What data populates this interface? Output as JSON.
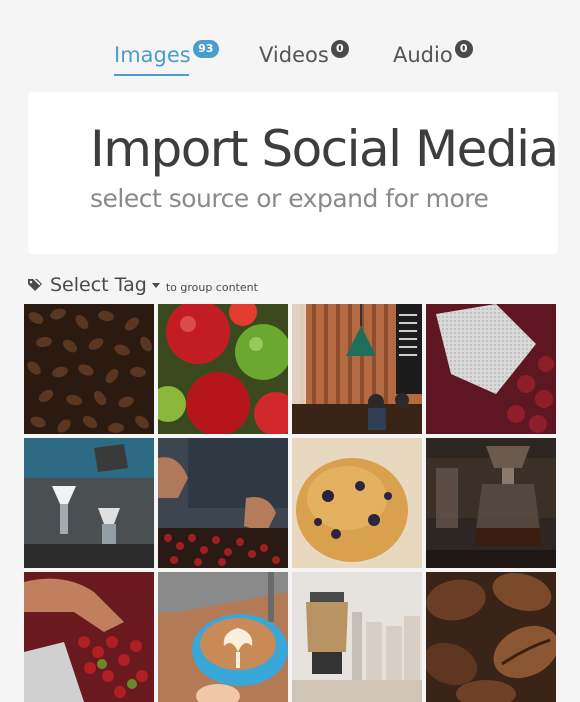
{
  "tabs": [
    {
      "label": "Images",
      "count": "93",
      "active": true
    },
    {
      "label": "Videos",
      "count": "0",
      "active": false
    },
    {
      "label": "Audio",
      "count": "0",
      "active": false
    }
  ],
  "hero": {
    "title": "Import Social Media",
    "subtitle": "select source or expand for more"
  },
  "tag_selector": {
    "label": "Select Tag",
    "hint": "to group content",
    "icon": "tags-icon"
  },
  "colors": {
    "accent": "#4a9ecb",
    "badge_dark": "#4a4a4a",
    "card_bg": "#ffffff",
    "page_bg": "#f5f5f5"
  },
  "gallery": {
    "images": [
      {
        "subject": "coffee-beans"
      },
      {
        "subject": "coffee-cherries"
      },
      {
        "subject": "cafe-interior"
      },
      {
        "subject": "coffee-sack"
      },
      {
        "subject": "pour-over-brewing"
      },
      {
        "subject": "sorting-beans"
      },
      {
        "subject": "muffin"
      },
      {
        "subject": "coffee-siphon"
      },
      {
        "subject": "harvest-cherries"
      },
      {
        "subject": "latte-art"
      },
      {
        "subject": "coffee-bar"
      },
      {
        "subject": "roasted-beans-closeup"
      }
    ]
  }
}
